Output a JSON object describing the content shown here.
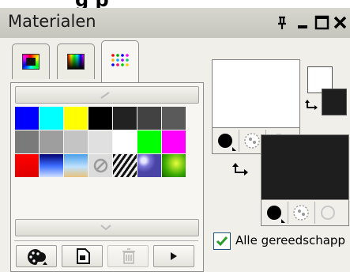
{
  "window": {
    "title": "Materialen",
    "heading_fragment": "g                  p",
    "controls": [
      "pin-icon",
      "minimize-icon",
      "maximize-icon",
      "close-icon"
    ]
  },
  "tabs": [
    {
      "name": "tab-frame",
      "icon": "gradient-frame-icon",
      "active": false
    },
    {
      "name": "tab-spectrum",
      "icon": "color-spectrum-icon",
      "active": false
    },
    {
      "name": "tab-swatches",
      "icon": "swatch-grid-icon",
      "active": true
    }
  ],
  "swatches": [
    "#0000ff",
    "#00ffff",
    "#ffff00",
    "#000000",
    "#222222",
    "#424242",
    "#5a5a5a",
    "#7a7a7a",
    "#9e9e9e",
    "#c4c4c4",
    "#e0e0e0",
    "#ffffff",
    "#00ff00",
    "#ff00ff",
    "gradient-red",
    "gradient-blue",
    "gradient-sky",
    "null-swatch",
    "pattern-zebra",
    "pattern-sphere",
    "pattern-green"
  ],
  "bottom_buttons": [
    {
      "name": "swatch-options-button",
      "icon": "palette-icon"
    },
    {
      "name": "new-swatch-button",
      "icon": "new-document-icon"
    },
    {
      "name": "delete-swatch-button",
      "icon": "trash-icon",
      "disabled": true
    },
    {
      "name": "more-button",
      "icon": "play-arrow-icon"
    }
  ],
  "properties": {
    "foreground_color": "#ffffff",
    "background_color": "#1e1e1e",
    "small_fg": "#ffffff",
    "small_bg": "#1e1e1e"
  },
  "checkbox": {
    "label": "Alle gereedschapp",
    "checked": true
  }
}
